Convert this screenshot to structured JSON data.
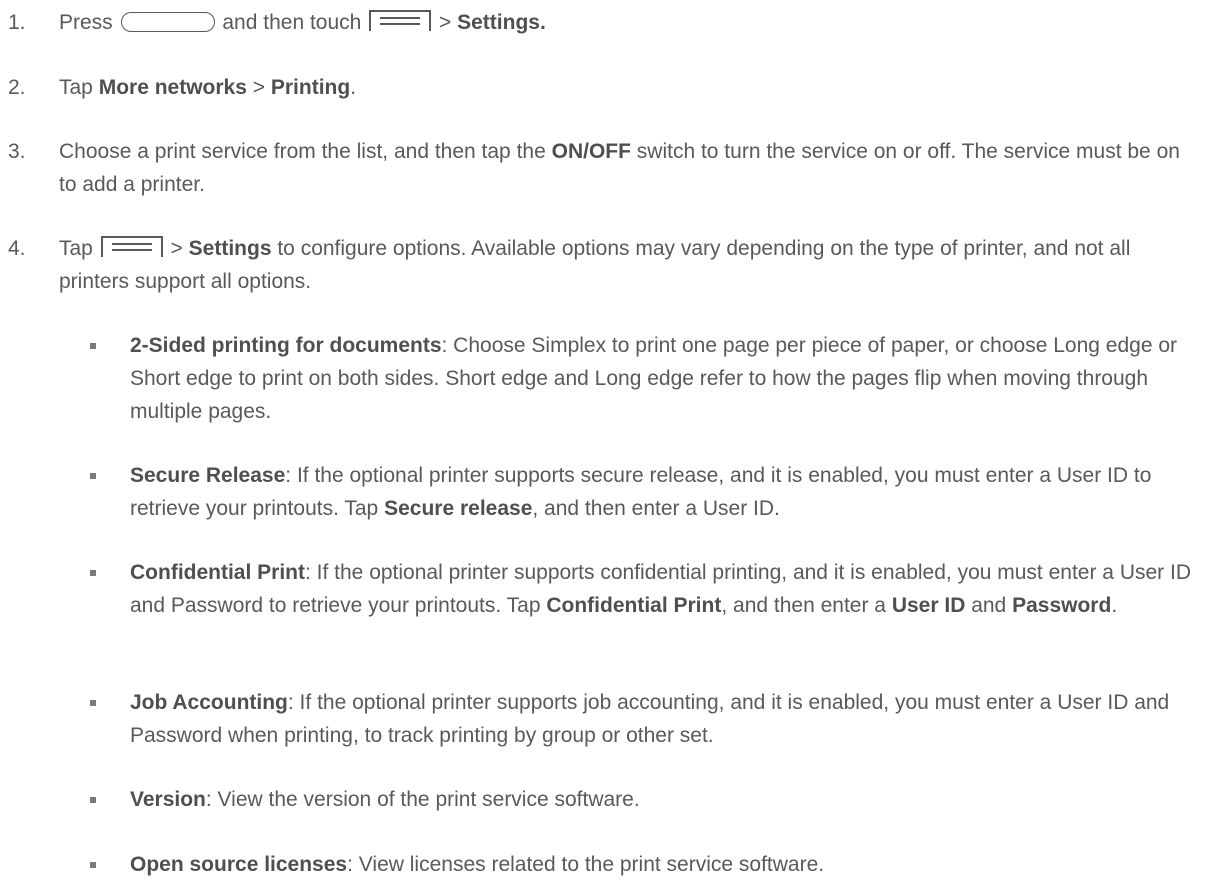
{
  "steps": [
    {
      "number": "1.",
      "t1": "Press",
      "t2": "and then touch",
      "t3": ">",
      "b1": "Settings."
    },
    {
      "number": "2.",
      "t1": "Tap",
      "b1": "More networks",
      "t2": ">",
      "b2": "Printing",
      "t3": "."
    },
    {
      "number": "3.",
      "t1": "Choose a print service from the list, and then tap the",
      "b1": "ON/OFF",
      "t2": "switch to turn the service on or off. The service must be on to add a printer."
    },
    {
      "number": "4.",
      "t1": "Tap",
      "t2": ">",
      "b1": "Settings",
      "t3": "to configure options. Available options may vary depending on the type of printer, and not all printers support all options."
    }
  ],
  "options": [
    {
      "title": "2-Sided printing for documents",
      "text": ": Choose Simplex to print one page per piece of paper, or choose Long edge or Short edge to print on both sides. Short edge and Long edge refer to how the pages flip when moving through multiple pages."
    },
    {
      "title": "Secure Release",
      "t1": ": If the optional printer supports secure release, and it is enabled, you must enter a User ID to retrieve your printouts. Tap",
      "b1": "Secure release",
      "t2": ", and then enter a User ID."
    },
    {
      "title": "Confidential Print",
      "t1": ": If the optional printer supports confidential printing, and it is enabled, you must enter a User ID and Password to retrieve your printouts. Tap",
      "b1": "Confidential Print",
      "t2": ", and then enter a",
      "b2": "User ID",
      "t3": "and",
      "b3": "Password",
      "t4": "."
    },
    {
      "title": "Job Accounting",
      "text": ": If the optional printer supports job accounting, and it is enabled, you must enter a User ID and Password when printing, to track printing by group or other set."
    },
    {
      "title": "Version",
      "text": ": View the version of the print service software."
    },
    {
      "title": "Open source licenses",
      "text": ": View licenses related to the print service software."
    }
  ],
  "icons": {
    "home_key": "home-key-icon",
    "menu_key": "menu-key-icon"
  },
  "colors": {
    "text": "#595959"
  }
}
